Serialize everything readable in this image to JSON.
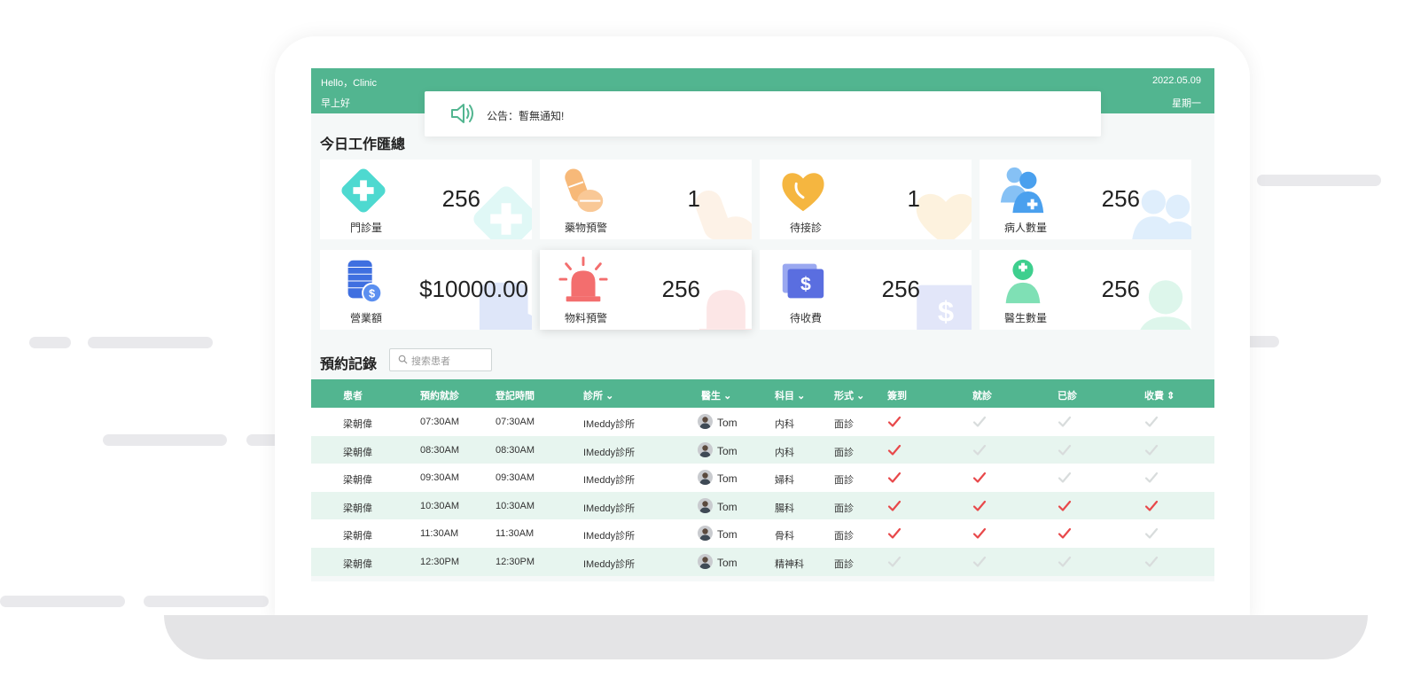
{
  "header": {
    "greeting": "Hello，Clinic",
    "sub_greeting": "早上好",
    "date": "2022.05.09",
    "weekday": "星期一"
  },
  "notice": {
    "text": "公告：暫無通知!"
  },
  "summary": {
    "title": "今日工作匯總",
    "cards": [
      {
        "label": "門診量",
        "value": "256",
        "icon": "medical-cross-icon",
        "color": "#4ed9d0"
      },
      {
        "label": "藥物預警",
        "value": "1",
        "icon": "pills-icon",
        "color": "#f7b979"
      },
      {
        "label": "待接診",
        "value": "1",
        "icon": "heart-phone-icon",
        "color": "#f5b640"
      },
      {
        "label": "病人數量",
        "value": "256",
        "icon": "patients-icon",
        "color": "#4aa0ee"
      },
      {
        "label": "營業額",
        "value": "$10000.00",
        "icon": "coins-icon",
        "color": "#3f6fe0"
      },
      {
        "label": "物料預警",
        "value": "256",
        "icon": "alarm-icon",
        "color": "#f36e6e"
      },
      {
        "label": "待收費",
        "value": "256",
        "icon": "cash-icon",
        "color": "#5a6ee0"
      },
      {
        "label": "醫生數量",
        "value": "256",
        "icon": "doctor-icon",
        "color": "#3ecf8e"
      }
    ]
  },
  "appointments": {
    "title": "預約記錄",
    "search_placeholder": "搜索患者",
    "columns": [
      {
        "label": "患者",
        "sort": ""
      },
      {
        "label": "預約就診",
        "sort": ""
      },
      {
        "label": "登記時間",
        "sort": ""
      },
      {
        "label": "診所",
        "sort": "⌄"
      },
      {
        "label": "醫生",
        "sort": "⌄"
      },
      {
        "label": "科目",
        "sort": "⌄"
      },
      {
        "label": "形式",
        "sort": "⌄"
      },
      {
        "label": "簽到",
        "sort": ""
      },
      {
        "label": "就診",
        "sort": ""
      },
      {
        "label": "已診",
        "sort": ""
      },
      {
        "label": "收費",
        "sort": "⇕"
      }
    ],
    "rows": [
      {
        "patient": "梁朝偉",
        "appt": "07:30AM",
        "reg": "07:30AM",
        "clinic": "IMeddy診所",
        "doctor": "Tom",
        "dept": "内科",
        "mode": "面診",
        "checks": [
          true,
          false,
          false,
          false
        ]
      },
      {
        "patient": "梁朝偉",
        "appt": "08:30AM",
        "reg": "08:30AM",
        "clinic": "IMeddy診所",
        "doctor": "Tom",
        "dept": "内科",
        "mode": "面診",
        "checks": [
          true,
          false,
          false,
          false
        ]
      },
      {
        "patient": "梁朝偉",
        "appt": "09:30AM",
        "reg": "09:30AM",
        "clinic": "IMeddy診所",
        "doctor": "Tom",
        "dept": "婦科",
        "mode": "面診",
        "checks": [
          true,
          true,
          false,
          false
        ]
      },
      {
        "patient": "梁朝偉",
        "appt": "10:30AM",
        "reg": "10:30AM",
        "clinic": "IMeddy診所",
        "doctor": "Tom",
        "dept": "腸科",
        "mode": "面診",
        "checks": [
          true,
          true,
          true,
          true
        ]
      },
      {
        "patient": "梁朝偉",
        "appt": "11:30AM",
        "reg": "11:30AM",
        "clinic": "IMeddy診所",
        "doctor": "Tom",
        "dept": "骨科",
        "mode": "面診",
        "checks": [
          true,
          true,
          true,
          false
        ]
      },
      {
        "patient": "梁朝偉",
        "appt": "12:30PM",
        "reg": "12:30PM",
        "clinic": "IMeddy診所",
        "doctor": "Tom",
        "dept": "精神科",
        "mode": "面診",
        "checks": [
          false,
          false,
          false,
          false
        ]
      }
    ]
  },
  "colors": {
    "accent": "#52b590",
    "row_alt": "#e7f5ef",
    "check_on": "#e8484a",
    "check_off": "#d8dcdc"
  }
}
